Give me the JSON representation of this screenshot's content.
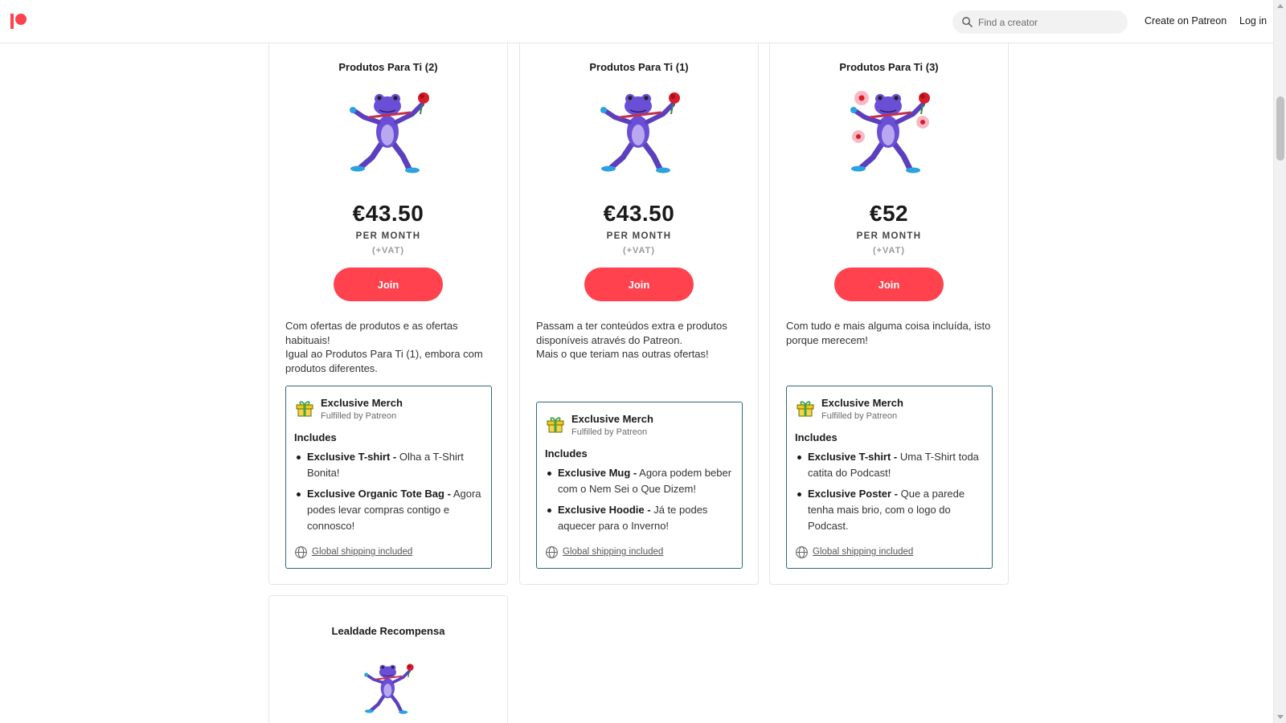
{
  "header": {
    "search_placeholder": "Find a creator",
    "create_label": "Create on Patreon",
    "login_label": "Log in"
  },
  "colors": {
    "brand": "#ff424d",
    "merch_border": "#2d6a7a"
  },
  "tiers": [
    {
      "title": "Produtos Para Ti (2)",
      "price": "€43.50",
      "per_month": "PER MONTH",
      "vat": "(+VAT)",
      "join_label": "Join",
      "description": [
        "Com ofertas de produtos e as ofertas habituais!",
        "Igual ao Produtos Para Ti (1), embora com produtos diferentes."
      ],
      "merch": {
        "title": "Exclusive Merch",
        "subtitle": "Fulfilled by Patreon",
        "includes_label": "Includes",
        "items": [
          {
            "name": "Exclusive T-shirt -",
            "text": " Olha a T-Shirt Bonita!"
          },
          {
            "name": "Exclusive Organic Tote Bag -",
            "text": " Agora podes levar compras contigo e connosco!"
          }
        ],
        "shipping": "Global shipping included"
      }
    },
    {
      "title": "Produtos Para Ti (1)",
      "price": "€43.50",
      "per_month": "PER MONTH",
      "vat": "(+VAT)",
      "join_label": "Join",
      "description": [
        "Passam a ter conteúdos extra e produtos disponíveis através do Patreon.",
        "Mais o que teriam nas outras ofertas!"
      ],
      "merch": {
        "title": "Exclusive Merch",
        "subtitle": "Fulfilled by Patreon",
        "includes_label": "Includes",
        "items": [
          {
            "name": "Exclusive Mug -",
            "text": " Agora podem beber com o Nem Sei o Que Dizem!"
          },
          {
            "name": "Exclusive Hoodie -",
            "text": " Já te podes aquecer para o Inverno!"
          }
        ],
        "shipping": "Global shipping included"
      }
    },
    {
      "title": "Produtos Para Ti (3)",
      "price": "€52",
      "per_month": "PER MONTH",
      "vat": "(+VAT)",
      "join_label": "Join",
      "description": [
        "Com tudo e mais alguma coisa incluída, isto porque merecem!"
      ],
      "merch": {
        "title": "Exclusive Merch",
        "subtitle": "Fulfilled by Patreon",
        "includes_label": "Includes",
        "items": [
          {
            "name": "Exclusive T-shirt -",
            "text": " Uma T-Shirt toda catita do Podcast!"
          },
          {
            "name": "Exclusive Poster -",
            "text": " Que a parede tenha mais brio, com o logo do Podcast."
          }
        ],
        "shipping": "Global shipping included"
      }
    },
    {
      "title": "Lealdade Recompensa"
    }
  ]
}
